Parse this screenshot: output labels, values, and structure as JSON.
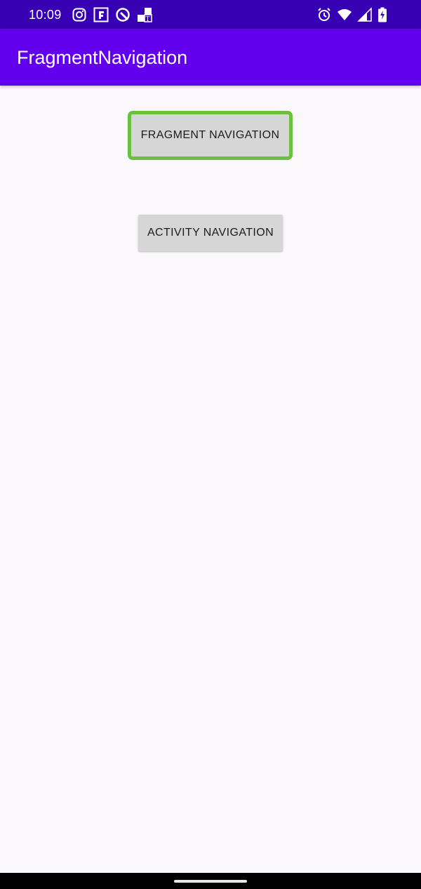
{
  "status_bar": {
    "time": "10:09",
    "left_icons": [
      "instagram-icon",
      "flipboard-icon",
      "q-app-icon",
      "nytimes-icon"
    ],
    "right_icons": [
      "alarm-icon",
      "wifi-icon",
      "cell-signal-icon",
      "battery-charging-icon"
    ],
    "background": "#3700b3"
  },
  "app_bar": {
    "title": "FragmentNavigation",
    "background": "#6200ee"
  },
  "main": {
    "buttons": [
      {
        "label": "FRAGMENT NAVIGATION",
        "focused": true,
        "focus_color": "#6ac13f"
      },
      {
        "label": "ACTIVITY NAVIGATION",
        "focused": false
      }
    ]
  }
}
